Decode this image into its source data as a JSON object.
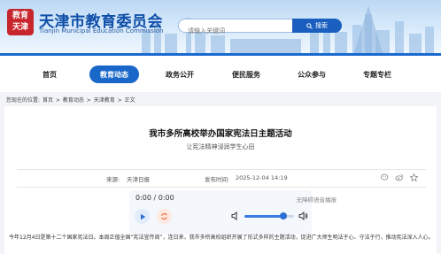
{
  "header": {
    "logo_text": "教育\n天津",
    "title": "天津市教育委员会",
    "subtitle": "Tianjin Municipal Education Commission",
    "search_placeholder": "请输入关键词",
    "search_button": "搜索"
  },
  "nav": {
    "items": [
      {
        "label": "首页",
        "active": false
      },
      {
        "label": "教育动态",
        "active": true
      },
      {
        "label": "政务公开",
        "active": false
      },
      {
        "label": "便民服务",
        "active": false
      },
      {
        "label": "公众参与",
        "active": false
      },
      {
        "label": "专题专栏",
        "active": false
      }
    ]
  },
  "breadcrumb": {
    "prefix": "您现在的位置:",
    "items": [
      "首页",
      "教育动态",
      "天津教育",
      "正文"
    ],
    "separator": ">"
  },
  "article": {
    "title": "我市多所高校举办国家宪法日主题活动",
    "subtitle": "让宪法精神浸润学生心田",
    "source_label": "来源:",
    "source_value": "天津日报",
    "date_label": "发布时间:",
    "date_value": "2025-12-04 14:19",
    "body": "今年12月4日是第十二个国家宪法日。本周正值全国“宪法宣传周”，连日来，我市多所高校组织开展了形式多样的主题活动，促进广大师生明法于心、守法于行，推动宪法深入人心。"
  },
  "player": {
    "time": "0:00 / 0:00",
    "tts_label": "无障碍语音播报",
    "volume_level": 0.78
  },
  "share_icons": [
    "wechat-icon",
    "weibo-icon",
    "qzone-icon"
  ],
  "colors": {
    "brand_blue": "#1867c9",
    "logo_red": "#c8262d",
    "play_blue": "#2d6fd6",
    "loop_orange": "#e8642f"
  }
}
